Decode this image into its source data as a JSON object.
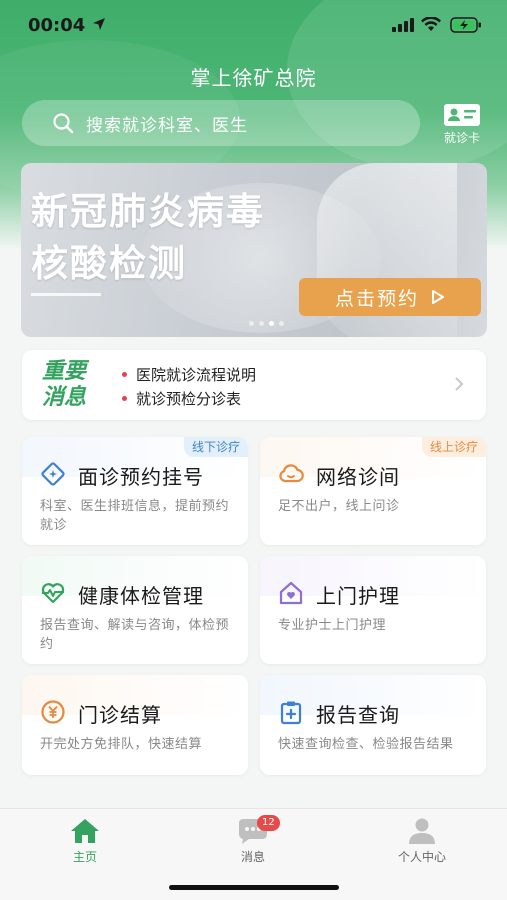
{
  "status_bar": {
    "time": "00:04"
  },
  "header": {
    "title": "掌上徐矿总院",
    "search_placeholder": "搜索就诊科室、医生",
    "card_button_label": "就诊卡"
  },
  "banner": {
    "line1": "新冠肺炎病毒",
    "line2": "核酸检测",
    "cta": "点击预约"
  },
  "notice": {
    "tag_line1": "重要",
    "tag_line2": "消息",
    "items": [
      "医院就诊流程说明",
      "就诊预检分诊表"
    ]
  },
  "services": [
    {
      "title": "面诊预约挂号",
      "desc": "科室、医生排班信息，提前预约就诊",
      "tag": "线下诊疗",
      "icon": "diamond-icon"
    },
    {
      "title": "网络诊间",
      "desc": "足不出户，线上问诊",
      "tag": "线上诊疗",
      "icon": "cloud-icon"
    },
    {
      "title": "健康体检管理",
      "desc": "报告查询、解读与咨询，体检预约",
      "tag": "",
      "icon": "heart-pulse-icon"
    },
    {
      "title": "上门护理",
      "desc": "专业护士上门护理",
      "tag": "",
      "icon": "home-heart-icon"
    },
    {
      "title": "门诊结算",
      "desc": "开完处方免排队，快速结算",
      "tag": "",
      "icon": "yuan-coin-icon"
    },
    {
      "title": "报告查询",
      "desc": "快速查询检查、检验报告结果",
      "tag": "",
      "icon": "clipboard-icon"
    }
  ],
  "tabbar": {
    "tabs": [
      {
        "label": "主页",
        "icon": "home-icon",
        "active": true
      },
      {
        "label": "消息",
        "icon": "chat-icon",
        "badge": "12"
      },
      {
        "label": "个人中心",
        "icon": "user-icon"
      }
    ]
  },
  "colors": {
    "brand_green": "#34a35f",
    "cta_orange": "#e8a24d",
    "offline_tag_blue": "#3d84c6",
    "online_tag_orange": "#e58a3f",
    "badge_red": "#e84a4a"
  }
}
